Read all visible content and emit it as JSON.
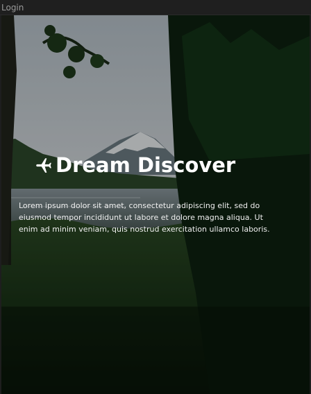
{
  "window": {
    "title": "Login"
  },
  "hero": {
    "brand_icon": "airplane-icon",
    "brand_name": "Dream Discover",
    "description": "Lorem ipsum dolor sit amet, consectetur adipiscing elit, sed do eiusmod tempor incididunt ut labore et dolore magna aliqua. Ut enim ad minim veniam, quis nostrud exercitation ullamco laboris.",
    "colors": {
      "text": "#ffffff",
      "forest": "#0f2a14",
      "sky": "#c9d3da"
    }
  }
}
